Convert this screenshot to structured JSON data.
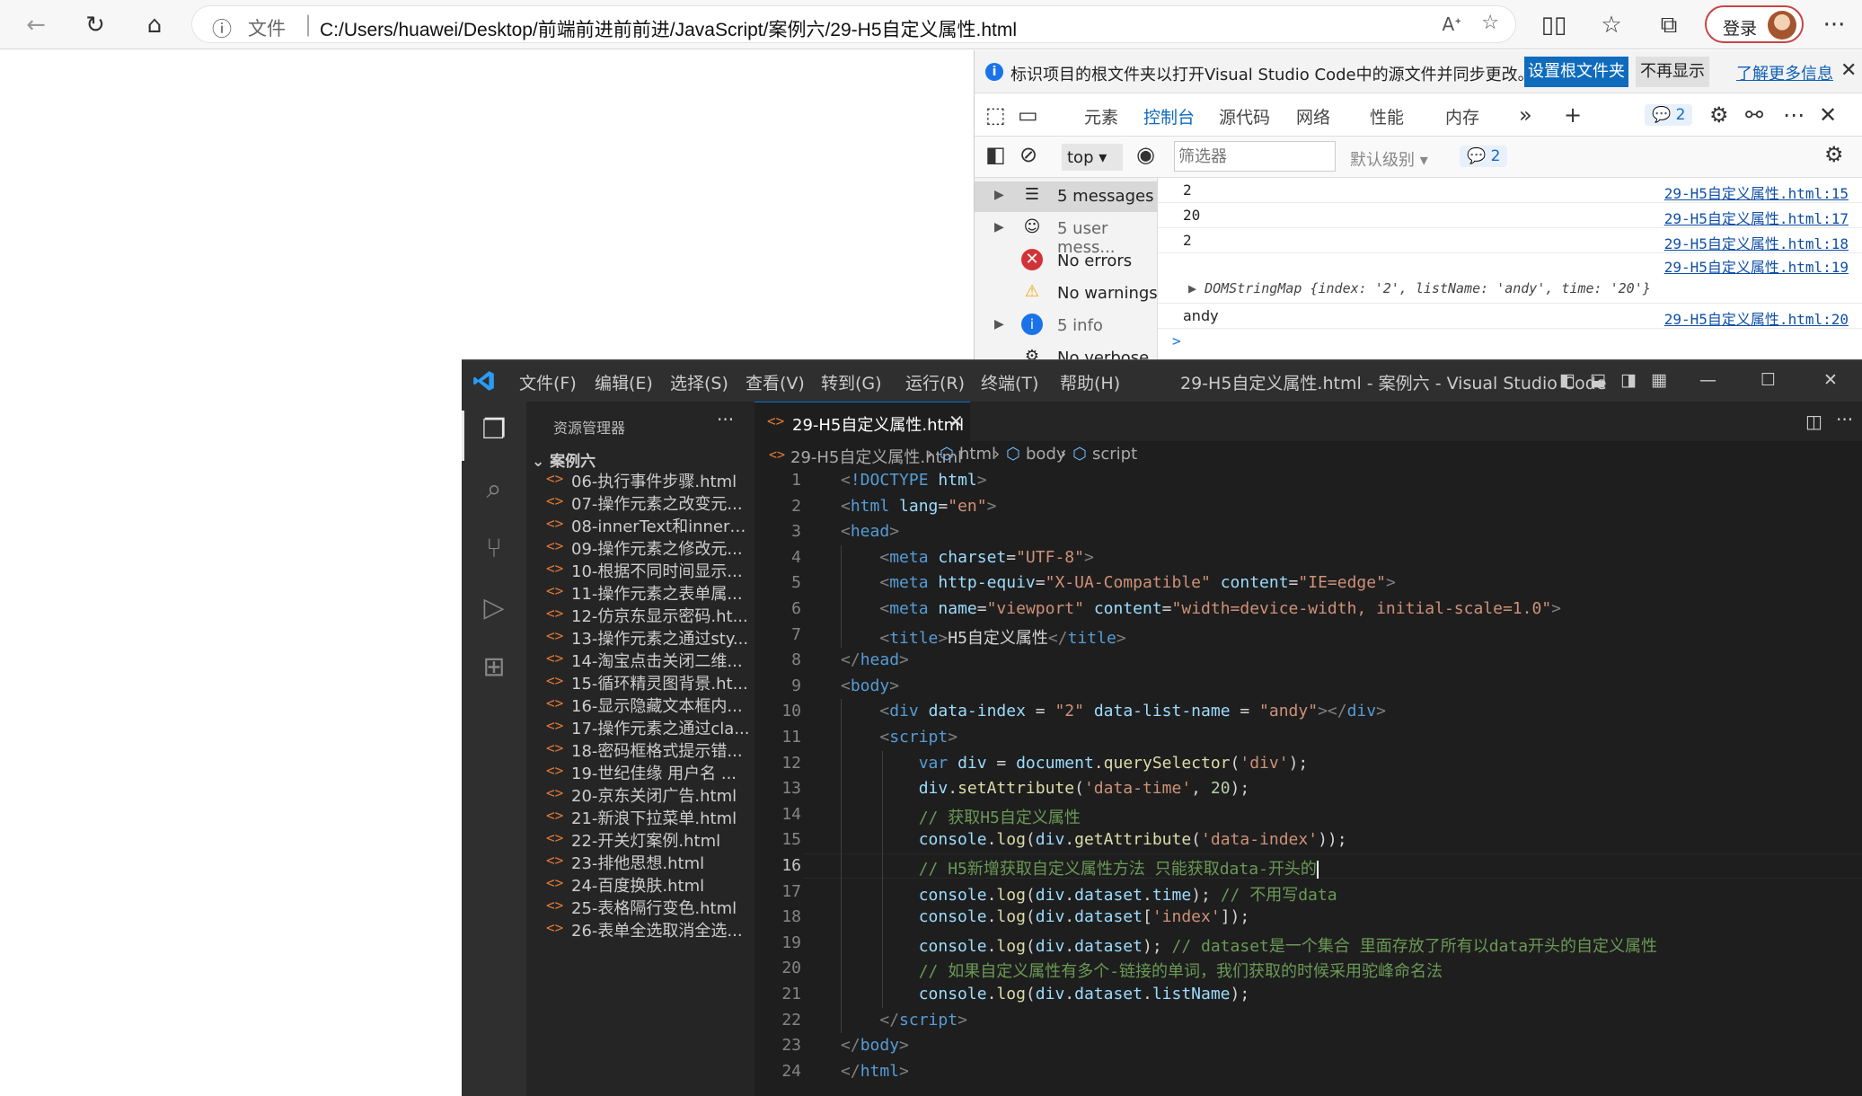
{
  "browser": {
    "file_label": "文件",
    "url": "C:/Users/huawei/Desktop/前端前进前前进/JavaScript/案例六/29-H5自定义属性.html",
    "login_label": "登录"
  },
  "devtools": {
    "notice": {
      "text": "标识项目的根文件夹以打开Visual Studio Code中的源文件并同步更改。",
      "set_root_label": "设置根文件夹",
      "dont_show_label": "不再显示",
      "learn_more_label": "了解更多信息"
    },
    "tabs": [
      "元素",
      "控制台",
      "源代码",
      "网络",
      "性能",
      "内存"
    ],
    "issues_count": "2",
    "context": "top",
    "filter_placeholder": "筛选器",
    "levels_label": "默认级别",
    "filter_issues_count": "2",
    "sidebar": [
      {
        "label": "5 messages"
      },
      {
        "label": "5 user mess..."
      },
      {
        "label": "No errors"
      },
      {
        "label": "No warnings"
      },
      {
        "label": "5 info"
      },
      {
        "label": "No verbose"
      }
    ],
    "console": [
      {
        "value": "2",
        "source": "29-H5自定义属性.html:15"
      },
      {
        "value": "20",
        "source": "29-H5自定义属性.html:17"
      },
      {
        "value": "2",
        "source": "29-H5自定义属性.html:18"
      },
      {
        "value": "DOMStringMap {index: '2', listName: 'andy', time: '20'}",
        "source": "29-H5自定义属性.html:19"
      },
      {
        "value": "andy",
        "source": "29-H5自定义属性.html:20"
      }
    ],
    "prompt": ">"
  },
  "vscode": {
    "menu": [
      "文件(F)",
      "编辑(E)",
      "选择(S)",
      "查看(V)",
      "转到(G)",
      "运行(R)",
      "终端(T)",
      "帮助(H)"
    ],
    "window_title": "29-H5自定义属性.html - 案例六 - Visual Studio Code",
    "explorer_title": "资源管理器",
    "folder": "案例六",
    "files": [
      "06-执行事件步骤.html",
      "07-操作元素之改变元...",
      "08-innerText和innerH...",
      "09-操作元素之修改元...",
      "10-根据不同时间显示...",
      "11-操作元素之表单属...",
      "12-仿京东显示密码.ht...",
      "13-操作元素之通过sty...",
      "14-淘宝点击关闭二维...",
      "15-循环精灵图背景.ht...",
      "16-显示隐藏文本框内...",
      "17-操作元素之通过cla...",
      "18-密码框格式提示错...",
      "19-世纪佳缘 用户名 ...",
      "20-京东关闭广告.html",
      "21-新浪下拉菜单.html",
      "22-开关灯案例.html",
      "23-排他思想.html",
      "24-百度换肤.html",
      "25-表格隔行变色.html",
      "26-表单全选取消全选..."
    ],
    "tab_label": "29-H5自定义属性.html",
    "breadcrumb": [
      "29-H5自定义属性.html",
      "html",
      "body",
      "script"
    ],
    "current_line": 16,
    "accent": "#0078d4"
  }
}
